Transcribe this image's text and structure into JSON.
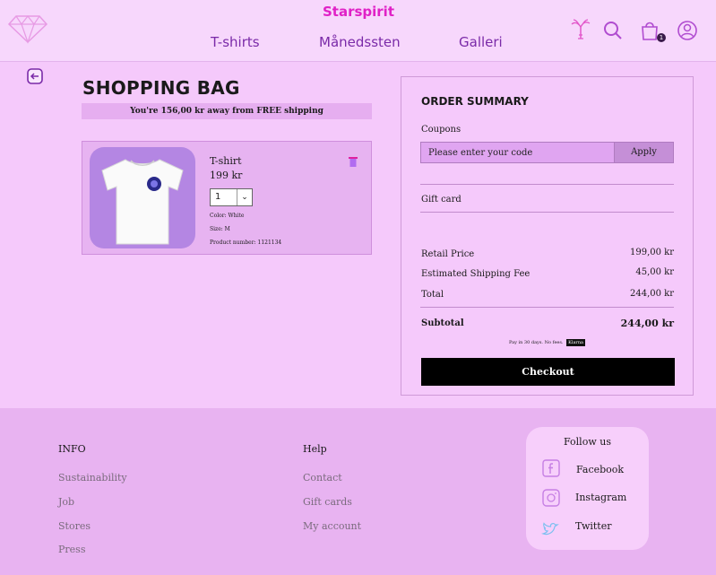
{
  "header": {
    "brand": "Starspirit",
    "nav": [
      "T-shirts",
      "Månedssten",
      "Galleri"
    ],
    "cart_count": "1"
  },
  "bag": {
    "title": "SHOPPING BAG",
    "shipping_note": "You're 156,00 kr away from FREE shipping",
    "item": {
      "name": "T-shirt",
      "price": "199 kr",
      "quantity": "1",
      "color": "Color: White",
      "size": "Size: M",
      "product_number": "Product number: 1121134"
    }
  },
  "summary": {
    "title": "ORDER SUMMARY",
    "coupons_label": "Coupons",
    "coupon_placeholder": "Please enter your code",
    "apply_label": "Apply",
    "gift_card_label": "Gift card",
    "retail_label": "Retail Price",
    "retail_value": "199,00 kr",
    "shipping_label": "Estimated Shipping Fee",
    "shipping_value": "45,00 kr",
    "total_label": "Total",
    "total_value": "244,00 kr",
    "subtotal_label": "Subtotal",
    "subtotal_value": "244,00 kr",
    "pay_note": "Pay in 30 days. No fees.",
    "pay_badge": "Klarna",
    "checkout_label": "Checkout"
  },
  "footer": {
    "info_title": "INFO",
    "info_links": [
      "Sustainability",
      "Job",
      "Stores",
      "Press"
    ],
    "help_title": "Help",
    "help_links": [
      "Contact",
      "Gift cards",
      "My account"
    ],
    "follow_title": "Follow us",
    "social": [
      "Facebook",
      "Instagram",
      "Twitter"
    ]
  },
  "colors": {
    "brand": "#e021c6",
    "nav": "#7a2aa8",
    "background": "#f5c9fb",
    "footer": "#e8b3f1"
  }
}
